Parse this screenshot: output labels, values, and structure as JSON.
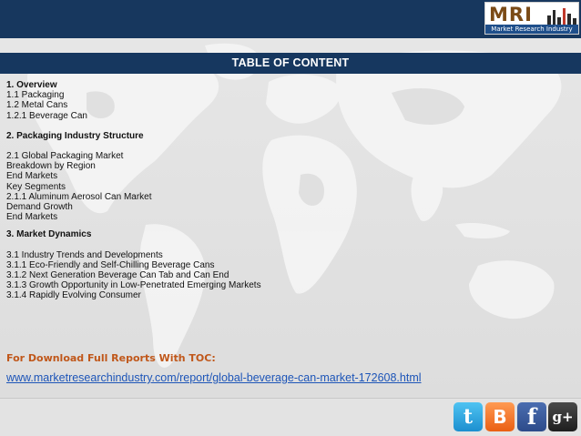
{
  "logo": {
    "mark": "MRI",
    "tagline": "Market Research Industry"
  },
  "header": {
    "title": "TABLE OF CONTENT"
  },
  "toc": {
    "items": [
      "1. Overview",
      "1.1 Packaging",
      "1.2 Metal Cans",
      "1.2.1 Beverage Can",
      "2. Packaging Industry Structure",
      "2.1 Global Packaging Market",
      "Breakdown by Region",
      "End Markets",
      "Key Segments",
      "2.1.1 Aluminum Aerosol Can Market",
      "Demand Growth",
      "End Markets",
      "3. Market Dynamics",
      "3.1 Industry Trends and Developments",
      "3.1.1 Eco-Friendly and Self-Chilling Beverage Cans",
      "3.1.2 Next Generation Beverage Can Tab and Can End",
      "3.1.3 Growth Opportunity in Low-Penetrated Emerging Markets",
      "3.1.4 Rapidly Evolving Consumer"
    ]
  },
  "download": {
    "label": "For Download Full Reports With TOC:",
    "url": "www.marketresearchindustry.com/report/global-beverage-can-market-172608.html"
  },
  "social": {
    "icons": [
      "twitter-icon",
      "blogger-icon",
      "facebook-icon",
      "google-plus-icon"
    ],
    "glyphs": [
      "t",
      "B",
      "f",
      "g+"
    ]
  },
  "colors": {
    "header_bar": "#17375e",
    "download_label": "#c0571a",
    "link": "#1d55b8"
  }
}
